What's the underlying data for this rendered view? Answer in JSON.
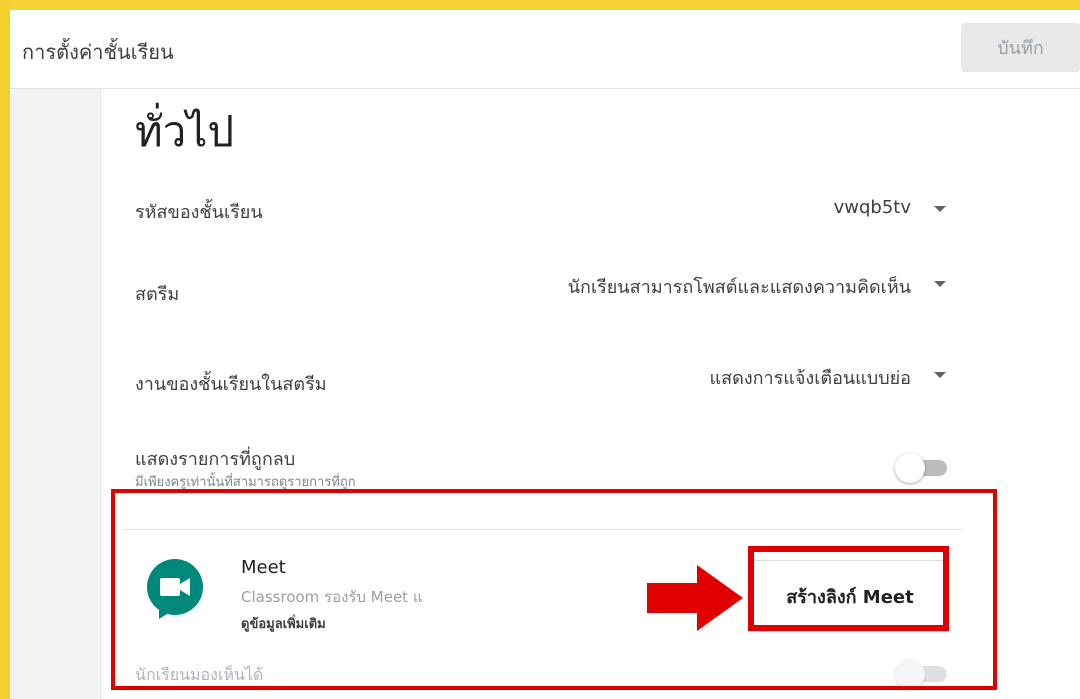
{
  "header": {
    "title": "การตั้งค่าชั้นเรียน",
    "save_label": "บันทึก"
  },
  "general": {
    "section_title": "ทั่วไป",
    "class_code": {
      "label": "รหัสของชั้นเรียน",
      "value": "vwqb5tv"
    },
    "stream": {
      "label": "สตรีม",
      "value": "นักเรียนสามารถโพสต์และแสดงความคิดเห็น"
    },
    "classwork_on_stream": {
      "label": "งานของชั้นเรียนในสตรีม",
      "value": "แสดงการแจ้งเตือนแบบย่อ"
    },
    "show_deleted": {
      "label": "แสดงรายการที่ถูกลบ",
      "sublabel": "มีเพียงครูเท่านั้นที่สามารถดูรายการที่ถูก",
      "enabled": false
    }
  },
  "meet": {
    "name": "Meet",
    "description": "Classroom รองรับ Meet แ",
    "learn_more": "ดูข้อมูลเพิ่มเติม",
    "create_button": "สร้างลิงก์ Meet",
    "students_visible_label": "นักเรียนมองเห็นได้",
    "students_visible_enabled": false
  },
  "colors": {
    "frame_yellow": "#f4d23a",
    "annotation_red": "#e10000",
    "meet_green": "#00897b"
  },
  "icons": {
    "meet_logo": "google-meet-icon",
    "dropdown": "caret-down-icon",
    "annotation_arrow": "red-arrow-right-icon"
  }
}
